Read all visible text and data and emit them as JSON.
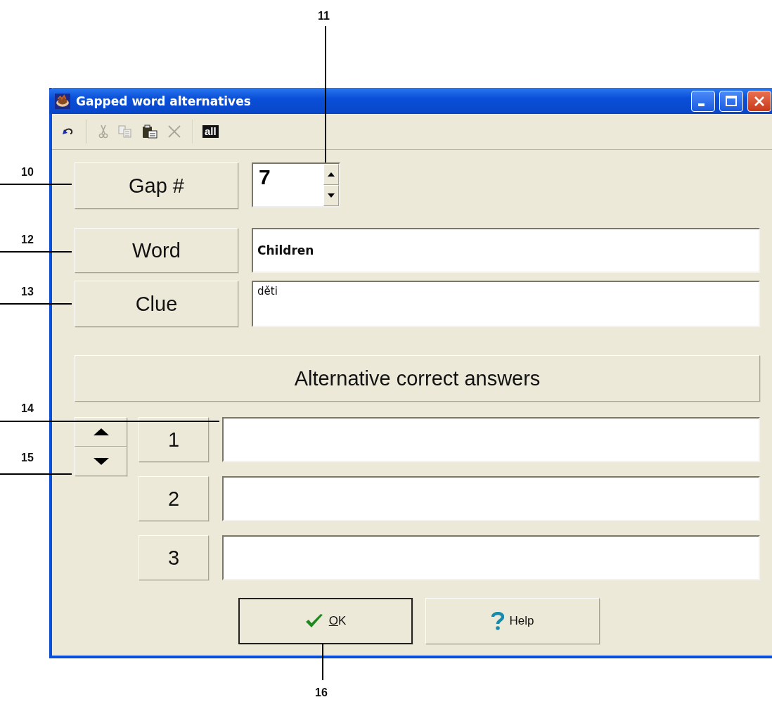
{
  "window": {
    "title": "Gapped word alternatives"
  },
  "toolbar": [
    {
      "kind": "undo",
      "disabled": false
    },
    {
      "kind": "separator"
    },
    {
      "kind": "cut",
      "disabled": true
    },
    {
      "kind": "copy",
      "disabled": true
    },
    {
      "kind": "paste",
      "disabled": false
    },
    {
      "kind": "delete",
      "disabled": true
    },
    {
      "kind": "separator"
    },
    {
      "kind": "select-all",
      "label": "all",
      "disabled": false
    }
  ],
  "gap": {
    "label": "Gap #",
    "value": "7"
  },
  "word": {
    "label": "Word",
    "value": "Children"
  },
  "clue": {
    "label": "Clue",
    "value": "děti"
  },
  "alternatives": {
    "title": "Alternative correct answers",
    "rows": [
      {
        "number": "1"
      },
      {
        "number": "2"
      },
      {
        "number": "3"
      }
    ]
  },
  "buttons": [
    {
      "kind": "ok",
      "label": "OK",
      "access_key": true,
      "default": true
    },
    {
      "kind": "help",
      "label": "Help",
      "default": false
    }
  ],
  "callouts": [
    {
      "label": "11"
    },
    {
      "label": "10"
    },
    {
      "label": "12"
    },
    {
      "label": "13"
    },
    {
      "label": "14"
    },
    {
      "label": "15"
    },
    {
      "label": "16"
    }
  ]
}
